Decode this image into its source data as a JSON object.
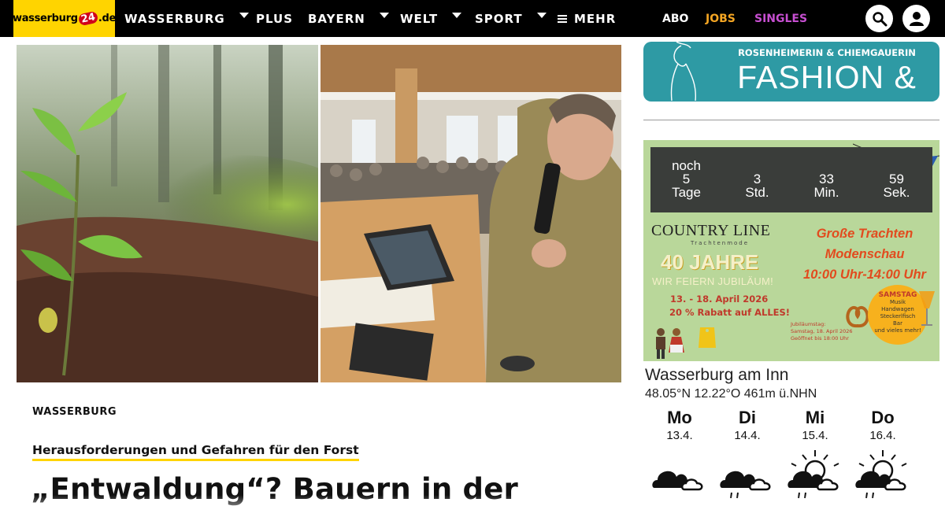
{
  "nav": {
    "logo": {
      "prefix": "wasserburg",
      "badge": "24",
      "suffix": ".de"
    },
    "items": [
      {
        "label": "WASSERBURG",
        "dropdown": true
      },
      {
        "label": "PLUS",
        "dropdown": false
      },
      {
        "label": "BAYERN",
        "dropdown": true
      },
      {
        "label": "WELT",
        "dropdown": true
      },
      {
        "label": "SPORT",
        "dropdown": true
      },
      {
        "label": "MEHR",
        "icon": "menu-icon"
      }
    ],
    "right_links": [
      {
        "label": "ABO",
        "color": "#ffffff"
      },
      {
        "label": "JOBS",
        "color": "#f5a623"
      },
      {
        "label": "SINGLES",
        "color": "#c74fd1"
      }
    ],
    "icons": [
      "search-icon",
      "user-icon"
    ]
  },
  "article": {
    "category": "WASSERBURG",
    "kicker": "Herausforderungen und Gefahren für den Forst",
    "headline": "„Entwaldung“? Bauern in der"
  },
  "ads": {
    "fashion": {
      "top": "ROSENHEIMERIN & CHIEMGAUERIN",
      "big": "FASHION & ART"
    },
    "countdown": {
      "days_prefix": "noch",
      "days": "5",
      "days_label": "Tage",
      "hours": "3",
      "hours_label": "Std.",
      "minutes": "33",
      "minutes_label": "Min.",
      "seconds": "59",
      "seconds_label": "Sek."
    },
    "country_line": {
      "brand": "COUNTRY LINE",
      "brand_sub": "Trachtenmode",
      "jahre": "40 JAHRE",
      "jubilaeum": "WIR FEIERN JUBILÄUM!",
      "dates": "13. - 18. April 2026",
      "rabatt": "20 % Rabatt auf ALLES!",
      "trachten_lines": [
        "Große Trachten",
        "Modenschau",
        "10:00 Uhr-14:00 Uhr"
      ],
      "jubil_small_lines": [
        "Jubiläumstag:",
        "Samstag, 18. April 2026",
        "Geöffnet bis 18:00 Uhr"
      ],
      "samstag_title": "SAMSTAG",
      "samstag_lines": [
        "Musik",
        "Handwagen",
        "Steckerlfisch",
        "Bar",
        "und vieles mehr!"
      ]
    }
  },
  "weather": {
    "city": "Wasserburg am Inn",
    "coords": "48.05°N 12.22°O 461m ü.NHN",
    "days": [
      {
        "name": "Mo",
        "date": "13.4.",
        "icon": "cloudy-icon"
      },
      {
        "name": "Di",
        "date": "14.4.",
        "icon": "cloudy-rain-icon"
      },
      {
        "name": "Mi",
        "date": "15.4.",
        "icon": "sun-cloud-rain-icon"
      },
      {
        "name": "Do",
        "date": "16.4.",
        "icon": "sun-cloud-rain-icon"
      }
    ]
  },
  "colors": {
    "accent": "#ffd400",
    "nav_bg": "#000000",
    "fashion_bg": "#2e9aa4",
    "ad_bg": "#b9d79a"
  }
}
